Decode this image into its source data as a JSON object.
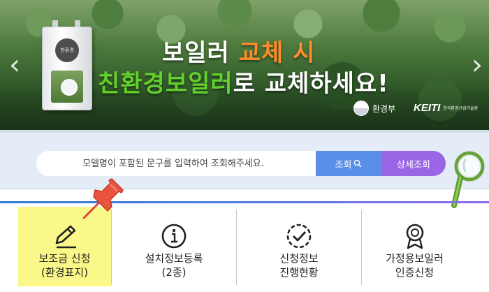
{
  "banner": {
    "line1_white": "보일러",
    "line1_accent": "교체 시",
    "line2_accent": "친환경보일러",
    "line2_white": "로 교체하세요!",
    "boiler_badge": "친환경",
    "logo_me": "환경부",
    "logo_keiti": "KEITI",
    "logo_keiti_sub": "한국환경산업기술원",
    "prev_icon": "chevron-left-icon",
    "next_icon": "chevron-right-icon",
    "colors": {
      "line1_accent": "#ff8c2a",
      "line2_accent": "#63d12b"
    }
  },
  "search": {
    "placeholder": "모델명이 포함된 문구를 입력하여 조회해주세요.",
    "search_label": "조회",
    "search_icon": "search-icon",
    "detail_label": "상세조회",
    "colors": {
      "search_button": "#5a8ee8",
      "detail_button": "#9b66e6"
    }
  },
  "menu": {
    "items": [
      {
        "icon": "pencil-icon",
        "line1": "보조금 신청",
        "line2": "(환경표지)",
        "active": true
      },
      {
        "icon": "info-icon",
        "line1": "설치정보등록",
        "line2": "(2종)",
        "active": false
      },
      {
        "icon": "check-circle-icon",
        "line1": "신청정보",
        "line2": "진행현황",
        "active": false
      },
      {
        "icon": "award-icon",
        "line1": "가정용보일러",
        "line2": "인증신청",
        "active": false
      }
    ],
    "active_color": "#fbf88a"
  }
}
